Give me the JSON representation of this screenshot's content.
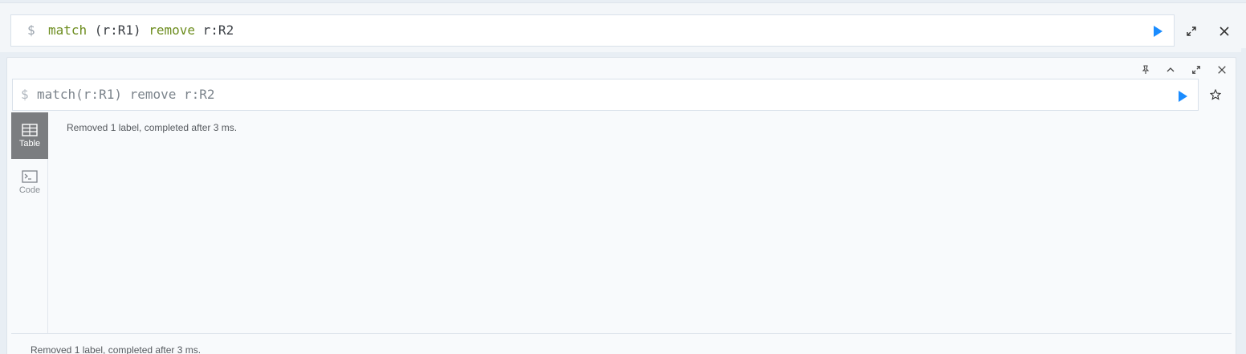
{
  "editor": {
    "prompt": "$",
    "query_parts": [
      {
        "text": "match",
        "kind": "keyword"
      },
      {
        "text": " (r:R1) ",
        "kind": "plain"
      },
      {
        "text": "remove",
        "kind": "keyword"
      },
      {
        "text": " r:R2",
        "kind": "plain"
      }
    ]
  },
  "frame": {
    "prompt": "$",
    "query": "match(r:R1) remove r:R2",
    "tabs": [
      {
        "label": "Table",
        "icon": "table-icon",
        "active": true
      },
      {
        "label": "Code",
        "icon": "terminal-icon",
        "active": false
      }
    ],
    "result_message": "Removed 1 label, completed after 3 ms.",
    "status_message": "Removed 1 label, completed after 3 ms."
  },
  "colors": {
    "accent": "#1a8cff",
    "keyword": "#6d8d1f",
    "active_tab": "#7b7d80"
  },
  "icons": [
    "play-icon",
    "expand-icon",
    "close-icon",
    "pin-icon",
    "collapse-icon",
    "fullscreen-icon",
    "star-icon"
  ]
}
